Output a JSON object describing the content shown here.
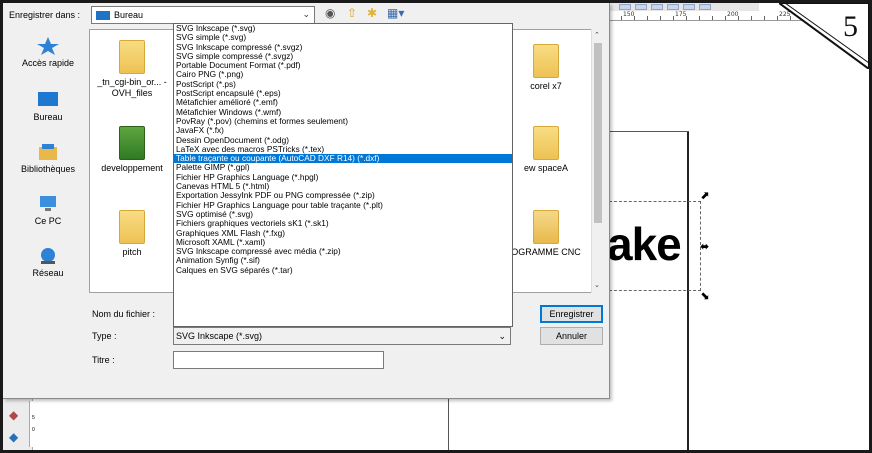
{
  "dialog": {
    "save_in_label": "Enregistrer dans :",
    "save_in_value": "Bureau",
    "filename_label": "Nom du fichier :",
    "type_label": "Type :",
    "title_label": "Titre :",
    "type_value": "SVG Inkscape (*.svg)",
    "save_button": "Enregistrer",
    "cancel_button": "Annuler"
  },
  "places": [
    "Accès rapide",
    "Bureau",
    "Bibliothèques",
    "Ce PC",
    "Réseau"
  ],
  "files": [
    "_tn_cgi-bin_or... - OVH_files",
    "developpement",
    "pitch",
    "corel x7",
    "ew spaceA",
    "OGRAMME CNC"
  ],
  "type_options": [
    "SVG Inkscape (*.svg)",
    "SVG simple (*.svg)",
    "SVG Inkscape compressé (*.svgz)",
    "SVG simple compressé (*.svgz)",
    "Portable Document Format (*.pdf)",
    "Cairo PNG (*.png)",
    "PostScript (*.ps)",
    "PostScript encapsulé (*.eps)",
    "Métafichier amélioré (*.emf)",
    "Métafichier Windows (*.wmf)",
    "PovRay (*.pov) (chemins et formes seulement)",
    "JavaFX (*.fx)",
    "Dessin OpenDocument (*.odg)",
    "LaTeX avec des macros PSTricks (*.tex)",
    "Table traçante ou coupante (AutoCAD DXF R14) (*.dxf)",
    "Palette GIMP (*.gpl)",
    "Fichier HP Graphics Language (*.hpgl)",
    "Canevas HTML 5 (*.html)",
    "Exportation JessyInk PDF ou PNG compressée (*.zip)",
    "Fichier HP Graphics Language pour table traçante (*.plt)",
    "SVG optimisé (*.svg)",
    "Fichiers graphiques vectoriels sK1 (*.sk1)",
    "Graphiques XML Flash (*.fxg)",
    "Microsoft XAML (*.xaml)",
    "SVG Inkscape compressé avec média (*.zip)",
    "Animation Synfig (*.sif)",
    "Calques en SVG séparés (*.tar)"
  ],
  "selected_option_index": 14,
  "canvas": {
    "logo_text": "ake",
    "step_number": "5",
    "ruler_ticks": [
      "150",
      "175",
      "200",
      "225",
      "250"
    ],
    "vruler_ticks": [
      "0",
      "5"
    ]
  },
  "colors": {
    "selection": "#0078d7",
    "folder": "#f2c94c",
    "dialog_bg": "#f0f0f0"
  },
  "icons": {
    "back": "back-arrow-icon",
    "up": "up-folder-icon",
    "new_folder": "new-folder-icon",
    "view": "view-menu-icon"
  }
}
